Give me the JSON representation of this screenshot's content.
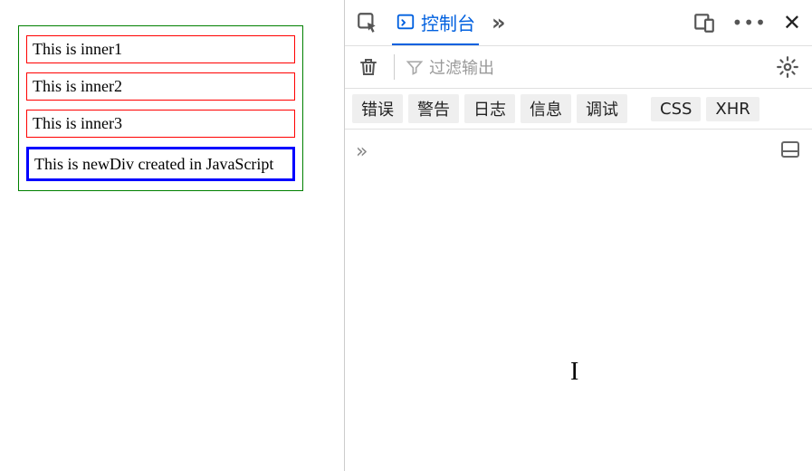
{
  "page": {
    "inners": [
      "This is inner1",
      "This is inner2",
      "This is inner3"
    ],
    "newdiv": "This is newDiv created in JavaScript"
  },
  "devtools": {
    "active_tab": "控制台",
    "filter_placeholder": "过滤输出",
    "chips": {
      "error": "错误",
      "warn": "警告",
      "log": "日志",
      "info": "信息",
      "debug": "调试",
      "css": "CSS",
      "xhr": "XHR"
    },
    "icons": {
      "inspector": "inspector-icon",
      "overflow_tabs": "»",
      "responsive": "responsive-icon",
      "more": "•••",
      "close": "✕",
      "trash": "trash-icon",
      "funnel": "funnel-icon",
      "gear": "gear-icon",
      "prompt": "»",
      "split": "split-console-icon"
    }
  }
}
